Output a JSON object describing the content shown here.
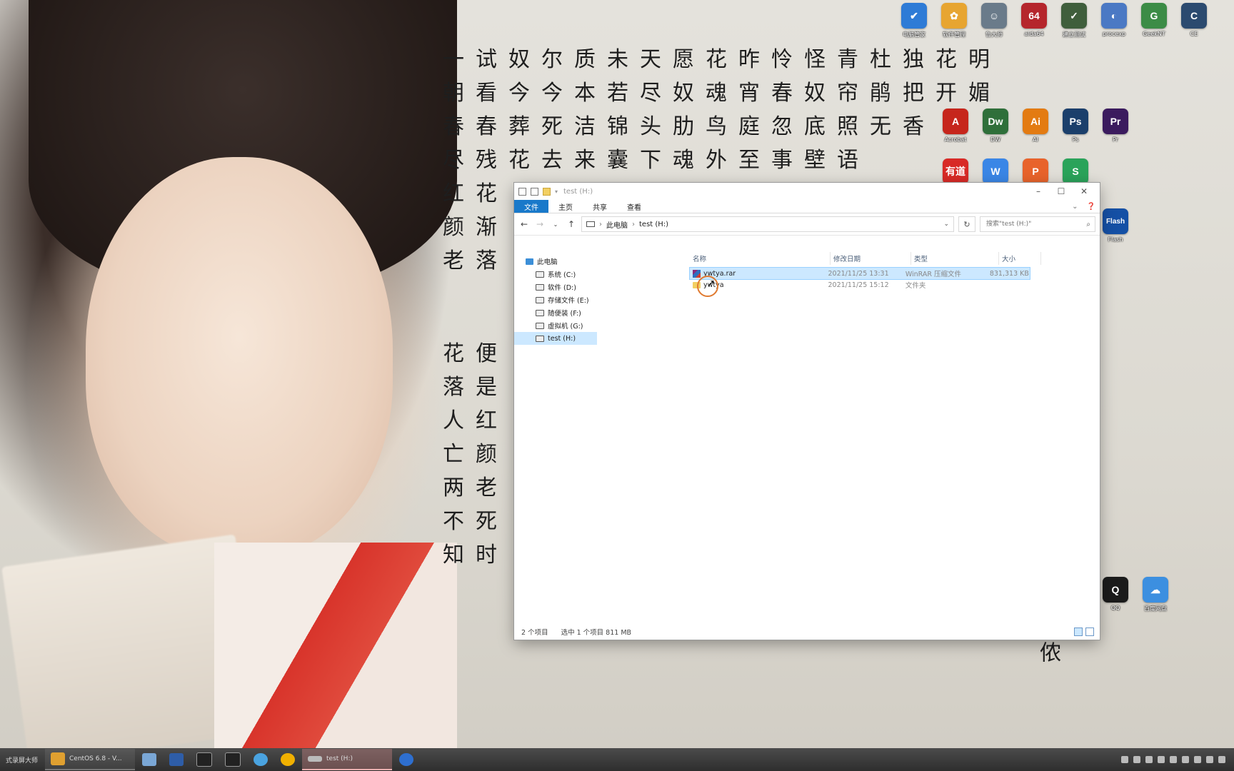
{
  "desktop": {
    "poem_columns": [
      "一试奴尔质未天愿花昨怜怪青杜独花明",
      "朝看今今本若尽奴魂宵春奴帘鹃把开媚",
      "春春葬死洁锦头肋鸟庭忽底照无香",
      "尽残花去来囊下魂外至事壁语",
      "红花",
      "颜渐",
      "老落"
    ],
    "poem_columns_lower": [
      "花便",
      "落是",
      "人红",
      "亡颜",
      "两老",
      "不死",
      "知时"
    ],
    "corner_char": "侬",
    "icons_top_row": [
      {
        "label": "电脑管家",
        "color": "#2e7bd6",
        "glyph": "✔",
        "icon": "shield-icon"
      },
      {
        "label": "软件管理",
        "color": "#e7a531",
        "glyph": "✿",
        "icon": "app-store-icon"
      },
      {
        "label": "鲁大师",
        "color": "#6a7b8a",
        "glyph": "☺",
        "icon": "ludashi-icon"
      },
      {
        "label": "aida64",
        "color": "#b5262c",
        "glyph": "64",
        "icon": "aida64-icon"
      },
      {
        "label": "建立测试",
        "color": "#3f5e3c",
        "glyph": "✓",
        "icon": "test-icon"
      },
      {
        "label": "procexp",
        "color": "#4b79c4",
        "glyph": "◐",
        "icon": "procexp-icon"
      },
      {
        "label": "GeekNT",
        "color": "#3c8c46",
        "glyph": "G",
        "icon": "geek-icon"
      },
      {
        "label": "CE",
        "color": "#2b4a6f",
        "glyph": "C",
        "icon": "cheat-engine-icon"
      }
    ],
    "icons_grid": [
      {
        "label": "Acrobat",
        "color": "#c6261c",
        "glyph": "A",
        "icon": "acrobat-icon"
      },
      {
        "label": "DW",
        "color": "#2f6f3a",
        "glyph": "Dw",
        "icon": "dreamweaver-icon"
      },
      {
        "label": "AI",
        "color": "#e37b12",
        "glyph": "Ai",
        "icon": "illustrator-icon"
      },
      {
        "label": "Ps",
        "color": "#1b3f6b",
        "glyph": "Ps",
        "icon": "photoshop-icon"
      },
      {
        "label": "Pr",
        "color": "#3b1b5e",
        "glyph": "Pr",
        "icon": "premiere-icon"
      },
      {
        "label": "有道",
        "color": "#d82a26",
        "glyph": "有道",
        "icon": "youdao-icon"
      },
      {
        "label": "WPS",
        "color": "#3a86e6",
        "glyph": "W",
        "icon": "wps-icon"
      },
      {
        "label": "WPP",
        "color": "#e8632b",
        "glyph": "P",
        "icon": "wpp-icon"
      },
      {
        "label": "WPS表格",
        "color": "#2aa35a",
        "glyph": "S",
        "icon": "et-icon"
      },
      {
        "label": "Flash",
        "color": "#1550a5",
        "glyph": "Flash",
        "icon": "flash-icon"
      },
      {
        "label": "QQ",
        "color": "#1b1b1b",
        "glyph": "Q",
        "icon": "qq-icon"
      },
      {
        "label": "百度网盘",
        "color": "#3c8fe0",
        "glyph": "☁",
        "icon": "baidu-netdisk-icon"
      }
    ]
  },
  "explorer": {
    "title": "test (H:)",
    "ribbon_tabs": [
      "文件",
      "主页",
      "共享",
      "查看"
    ],
    "address": {
      "segments": [
        "此电脑",
        "test (H:)"
      ]
    },
    "search_placeholder": "搜索\"test (H:)\"",
    "nav_tree": [
      {
        "label": "此电脑",
        "root": true
      },
      {
        "label": "系统 (C:)"
      },
      {
        "label": "软件 (D:)"
      },
      {
        "label": "存储文件 (E:)"
      },
      {
        "label": "随便装 (F:)"
      },
      {
        "label": "虚拟机 (G:)"
      },
      {
        "label": "test (H:)",
        "selected": true
      }
    ],
    "columns": [
      "名称",
      "修改日期",
      "类型",
      "大小"
    ],
    "files": [
      {
        "name": "ywtya.rar",
        "date": "2021/11/25 13:31",
        "type": "WinRAR 压缩文件",
        "size": "831,313 KB",
        "selected": true
      },
      {
        "name": "ywtya",
        "date": "2021/11/25 15:12",
        "type": "文件夹",
        "size": ""
      }
    ],
    "status": {
      "count": "2 个项目",
      "selection": "选中 1 个项目  811 MB"
    }
  },
  "taskbar": {
    "items": [
      {
        "label": "式录屏大师",
        "wide": false
      },
      {
        "label": "CentOS 6.8 - V...",
        "wide": true
      },
      {
        "label": "test (H:)",
        "wide": true,
        "active": true
      }
    ]
  }
}
